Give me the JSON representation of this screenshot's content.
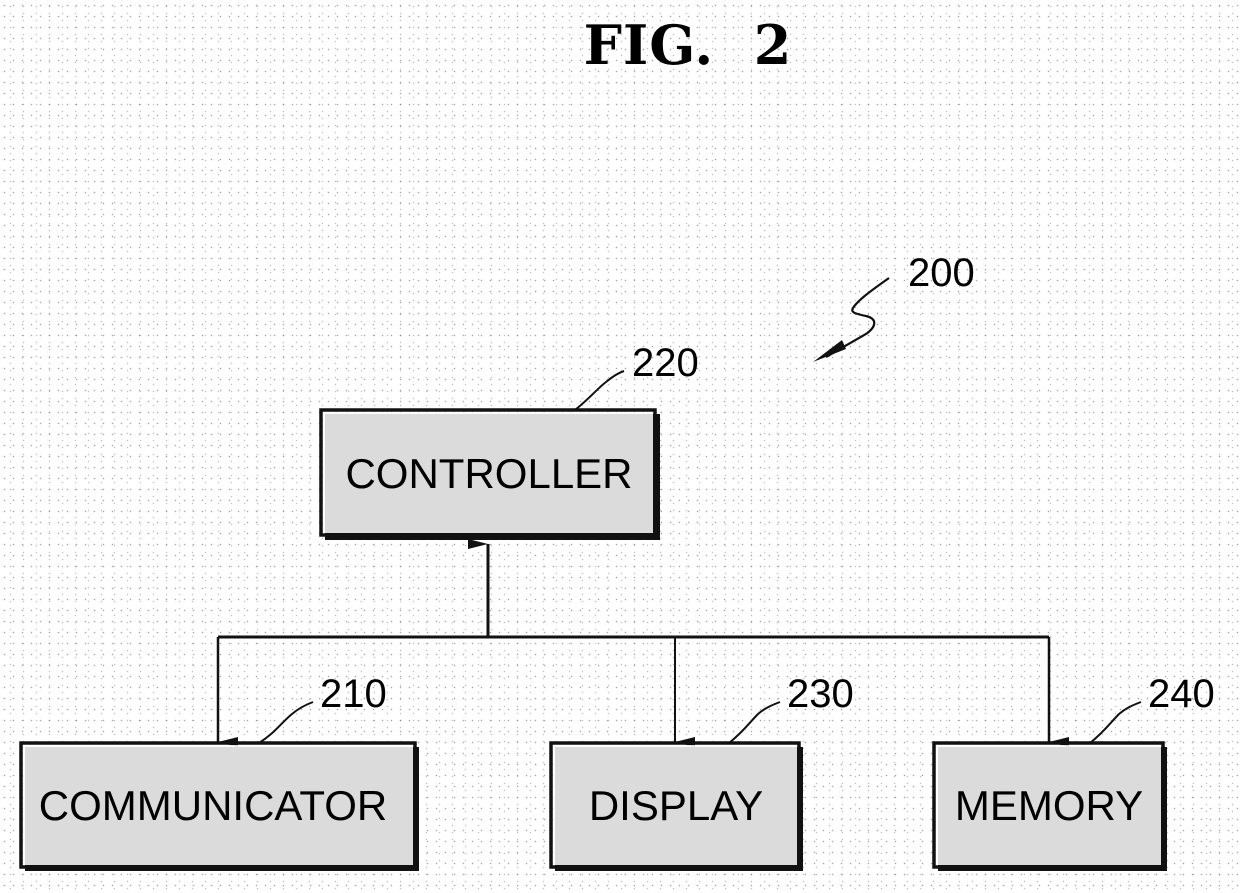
{
  "figure": {
    "title": "FIG.  2"
  },
  "system": {
    "ref": "200"
  },
  "blocks": {
    "controller": {
      "label": "CONTROLLER",
      "ref": "220"
    },
    "communicator": {
      "label": "COMMUNICATOR",
      "ref": "210"
    },
    "display": {
      "label": "DISPLAY",
      "ref": "230"
    },
    "memory": {
      "label": "MEMORY",
      "ref": "240"
    }
  },
  "connections": [
    {
      "from": "bus",
      "to": "controller"
    },
    {
      "from": "bus",
      "to": "communicator"
    },
    {
      "from": "bus",
      "to": "display"
    },
    {
      "from": "bus",
      "to": "memory"
    }
  ]
}
